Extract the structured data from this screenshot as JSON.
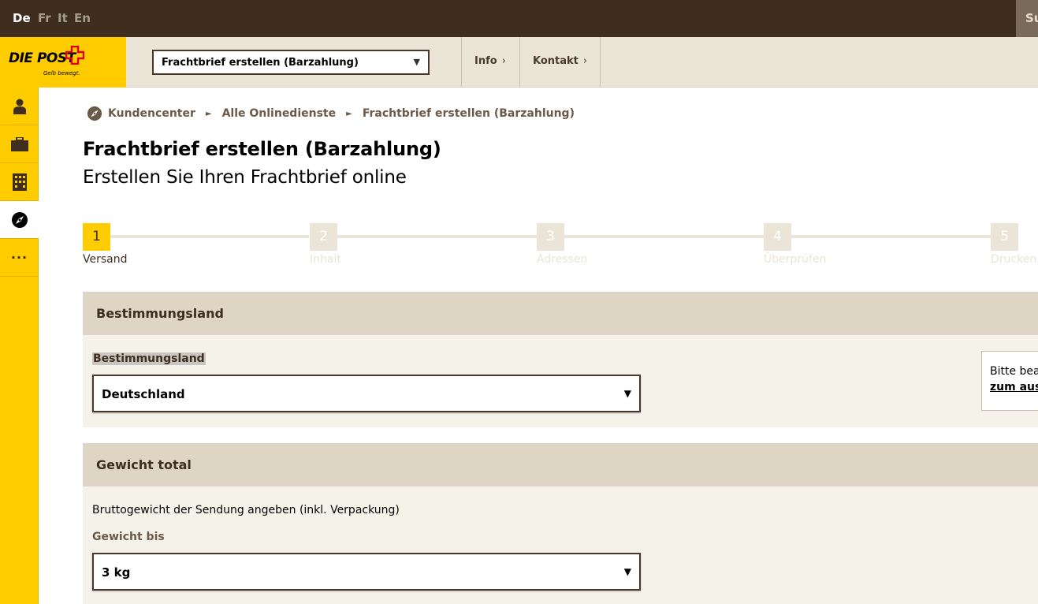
{
  "languages": [
    "De",
    "Fr",
    "It",
    "En"
  ],
  "topbar_right": "Su",
  "logo": {
    "text": "DIE POST",
    "slogan": "Gelb bewegt.",
    "cross_color": "#ff0000"
  },
  "header": {
    "service_select": "Frachtbrief erstellen (Barzahlung)",
    "nav": [
      {
        "label": "Info",
        "chevron": "›"
      },
      {
        "label": "Kontakt",
        "chevron": "›"
      }
    ]
  },
  "sidebar": {
    "items": [
      {
        "icon": "person-icon"
      },
      {
        "icon": "briefcase-icon"
      },
      {
        "icon": "building-icon"
      },
      {
        "icon": "compass-icon",
        "active": true
      },
      {
        "icon": "more-icon",
        "label": "···"
      }
    ]
  },
  "breadcrumb": {
    "items": [
      "Kundencenter",
      "Alle Onlinedienste",
      "Frachtbrief erstellen (Barzahlung)"
    ],
    "separator": "►"
  },
  "page": {
    "title": "Frachtbrief erstellen (Barzahlung)",
    "subtitle": "Erstellen Sie Ihren Frachtbrief online"
  },
  "stepper": {
    "current": 1,
    "steps": [
      {
        "number": "1",
        "label": "Versand"
      },
      {
        "number": "2",
        "label": "Inhalt"
      },
      {
        "number": "3",
        "label": "Adressen"
      },
      {
        "number": "4",
        "label": "Überprüfen"
      },
      {
        "number": "5",
        "label": "Drucken"
      }
    ]
  },
  "destination": {
    "heading": "Bestimmungsland",
    "field_label": "Bestimmungsland",
    "value": "Deutschland",
    "info_text": "Bitte bea",
    "info_link": "zum ausg"
  },
  "weight": {
    "heading": "Gewicht total",
    "description": "Bruttogewicht der Sendung angeben (inkl. Verpackung)",
    "field_label": "Gewicht bis",
    "value": "3 kg"
  },
  "colors": {
    "brand_yellow": "#ffcc00",
    "dark_brown": "#3f2d1e",
    "panel_head": "#dfd5c4",
    "panel_body": "#f5f2ea"
  }
}
